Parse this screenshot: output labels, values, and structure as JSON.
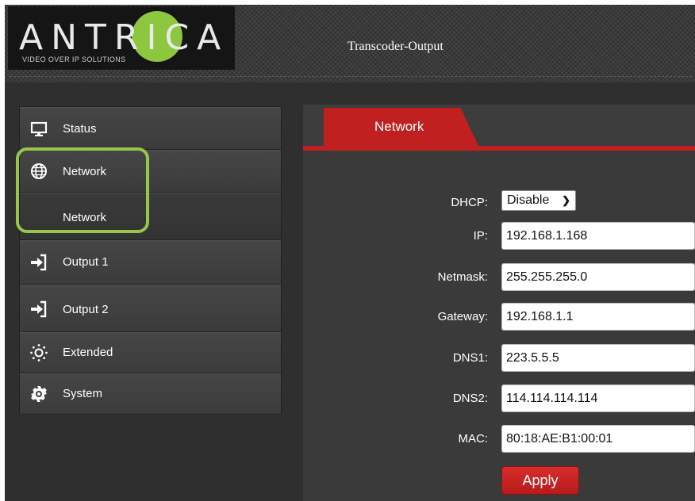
{
  "header": {
    "logo_text": "ANTRICA",
    "logo_tagline": "VIDEO OVER IP SOLUTIONS",
    "title": "Transcoder-Output"
  },
  "sidebar": {
    "items": [
      {
        "label": "Status",
        "icon": "monitor-icon"
      },
      {
        "label": "Network",
        "icon": "globe-icon"
      },
      {
        "label": "Network",
        "icon": ""
      },
      {
        "label": "Output 1",
        "icon": "sign-in-icon"
      },
      {
        "label": "Output 2",
        "icon": "sign-in-icon"
      },
      {
        "label": "Extended",
        "icon": "sun-icon"
      },
      {
        "label": "System",
        "icon": "gear-icon"
      }
    ],
    "highlight_color": "#99c54a"
  },
  "main": {
    "tab": {
      "label": "Network"
    },
    "form": {
      "dhcp": {
        "label": "DHCP",
        "value": "Disable"
      },
      "ip": {
        "label": "IP",
        "value": "192.168.1.168"
      },
      "netmask": {
        "label": "Netmask",
        "value": "255.255.255.0"
      },
      "gateway": {
        "label": "Gateway",
        "value": "192.168.1.1"
      },
      "dns1": {
        "label": "DNS1",
        "value": "223.5.5.5"
      },
      "dns2": {
        "label": "DNS2",
        "value": "114.114.114.114"
      },
      "mac": {
        "label": "MAC",
        "value": "80:18:AE:B1:00:01"
      }
    },
    "apply_label": "Apply"
  },
  "colors": {
    "accent_red": "#c0201f",
    "logo_green": "#8dc63f",
    "background_dark": "#2f2f2f"
  }
}
